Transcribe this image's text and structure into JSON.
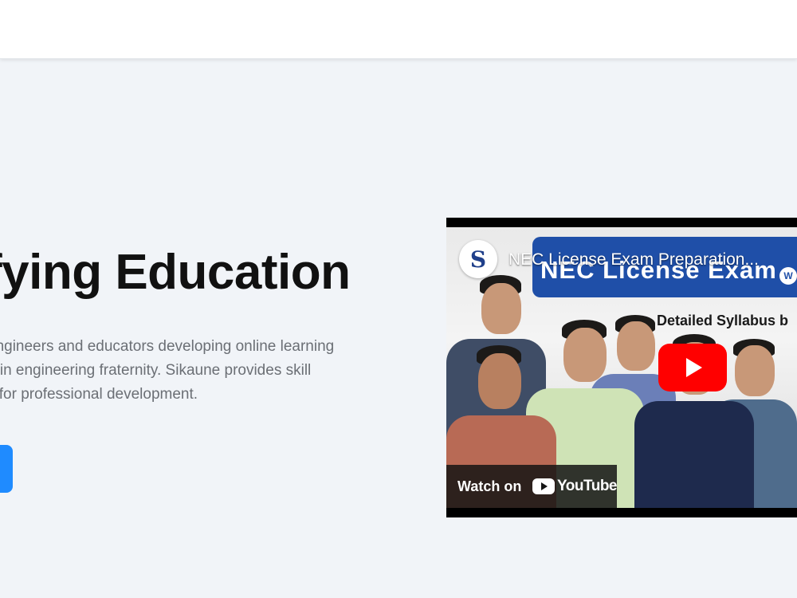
{
  "hero": {
    "title": "fying Education",
    "description_lines": [
      "engineers and educators developing online learning",
      "g in engineering fraternity. Sikaune provides skill",
      "s for professional development."
    ]
  },
  "video": {
    "title": "NEC License Exam Preparation...",
    "thumbnail_banner": "NEC License  Exam",
    "thumbnail_badge": "W",
    "thumbnail_subtitle": "Detailed Syllabus b",
    "channel_logo_letter": "S",
    "watch_on_label": "Watch on",
    "youtube_label": "YouTube"
  },
  "colors": {
    "accent": "#1f8bff",
    "page_background": "#f1f4f8",
    "youtube_red": "#ff0000",
    "banner_blue": "#1f4fa8"
  }
}
